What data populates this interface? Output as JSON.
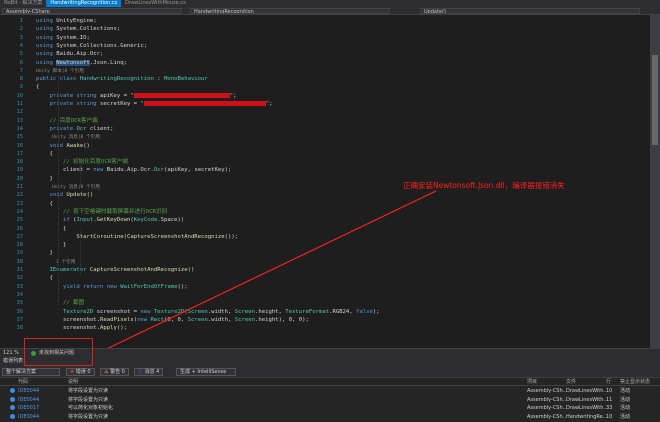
{
  "window": {
    "title_fragment": "NoBit · 解决方案"
  },
  "tabs": [
    {
      "label": "HandwritingRecognition.cs",
      "active": true
    },
    {
      "label": "DrawLinesWithMouse.cs",
      "active": false
    }
  ],
  "navbar": {
    "project": "Assembly-CSharp",
    "class": "HandwritingRecognition",
    "member": "Update()"
  },
  "code_lines": [
    {
      "n": "1",
      "html": "<span class=\"kw\">using</span> UnityEngine;"
    },
    {
      "n": "2",
      "html": "<span class=\"kw\">using</span> System.Collections;"
    },
    {
      "n": "3",
      "html": "<span class=\"kw\">using</span> System.IO;"
    },
    {
      "n": "4",
      "html": "<span class=\"kw\">using</span> System.Collections.Generic;"
    },
    {
      "n": "5",
      "html": "<span class=\"kw\">using</span> Baidu.Aip.Ocr;"
    },
    {
      "n": "6",
      "html": "<span class=\"kw\">using</span> <span class=\"hl\">Newtonsoft</span>.Json.Linq;"
    },
    {
      "n": "7",
      "html": ""
    },
    {
      "n": "8",
      "html": "<span class=\"kw\">public class</span> <span class=\"ty\">HandwritingRecognition</span> : <span class=\"ty\">MonoBehaviour</span>"
    },
    {
      "n": "9",
      "html": "{"
    },
    {
      "n": "10",
      "html": "    <span class=\"kw\">private string</span> apiKey = <span class=\"st\">\"<span class=\"redact\"></span>\"</span>;"
    },
    {
      "n": "11",
      "html": "    <span class=\"kw\">private string</span> secretKey = <span class=\"st\">\"<span class=\"redact2\"></span>\"</span>;"
    },
    {
      "n": "12",
      "html": ""
    },
    {
      "n": "13",
      "html": "    <span class=\"cm\">// 百度OCR客户端</span>"
    },
    {
      "n": "14",
      "html": "    <span class=\"kw\">private</span> <span class=\"ty\">Ocr</span> client;"
    },
    {
      "n": "15",
      "html": ""
    },
    {
      "n": "16",
      "html": "    <span class=\"kw\">void</span> <span class=\"fn\">Awake</span>()"
    },
    {
      "n": "17",
      "html": "    {"
    },
    {
      "n": "18",
      "html": "        <span class=\"cm\">// 初始化百度OCR客户端</span>"
    },
    {
      "n": "19",
      "html": "        client = <span class=\"kw\">new</span> Baidu.Aip.Ocr.<span class=\"ty\">Ocr</span>(apiKey, secretKey);"
    },
    {
      "n": "20",
      "html": "    }"
    },
    {
      "n": "21",
      "html": ""
    },
    {
      "n": "22",
      "html": "    <span class=\"kw\">void</span> <span class=\"fn\">Update</span>()"
    },
    {
      "n": "23",
      "html": "    {"
    },
    {
      "n": "24",
      "html": "        <span class=\"cm\">// 按下空格键时截取屏幕并进行OCR识别</span>"
    },
    {
      "n": "25",
      "html": "        <span class=\"kw\">if</span> (<span class=\"ty\">Input</span>.<span class=\"fn\">GetKeyDown</span>(<span class=\"ty\">KeyCode</span>.Space))"
    },
    {
      "n": "26",
      "html": "        {"
    },
    {
      "n": "27",
      "html": "            <span class=\"fn\">StartCoroutine</span>(<span class=\"fn\">CaptureScreenshotAndRecognize</span>());"
    },
    {
      "n": "28",
      "html": "        }"
    },
    {
      "n": "29",
      "html": "    }"
    },
    {
      "n": "30",
      "html": ""
    },
    {
      "n": "31",
      "html": "    <span class=\"ty\">IEnumerator</span> <span class=\"fn\">CaptureScreenshotAndRecognize</span>()"
    },
    {
      "n": "32",
      "html": "    {"
    },
    {
      "n": "33",
      "html": "        <span class=\"kw\">yield return new</span> <span class=\"ty\">WaitForEndOfFrame</span>();"
    },
    {
      "n": "34",
      "html": ""
    },
    {
      "n": "35",
      "html": "        <span class=\"cm\">// 截图</span>"
    },
    {
      "n": "36",
      "html": "        <span class=\"ty\">Texture2D</span> screenshot = <span class=\"kw\">new</span> <span class=\"ty\">Texture2D</span>(<span class=\"ty\">Screen</span>.width, <span class=\"ty\">Screen</span>.height, <span class=\"ty\">TextureFormat</span>.RGB24, <span class=\"kw\">false</span>);"
    },
    {
      "n": "37",
      "html": "        screenshot.<span class=\"fn\">ReadPixels</span>(<span class=\"kw\">new</span> <span class=\"ty\">Rect</span>(0, 0, <span class=\"ty\">Screen</span>.width, <span class=\"ty\">Screen</span>.height), 0, 0);"
    },
    {
      "n": "38",
      "html": "        screenshot.<span class=\"fn\">Apply</span>();"
    }
  ],
  "codelens": [
    {
      "after_line": "7",
      "text": "Unity 脚本|0 个引用"
    },
    {
      "after_line": "15",
      "text": "Unity 消息|0 个引用"
    },
    {
      "after_line": "21",
      "text": "Unity 消息|0 个引用"
    },
    {
      "after_line": "30",
      "text": "1 个引用"
    }
  ],
  "annotation": {
    "text": "正确安装Newtonsoft.Json.dll，编译器报错消失",
    "color": "#ff2020"
  },
  "statusbar": {
    "zoom": "121 %",
    "issues": "未找到相关问题"
  },
  "error_panel": {
    "title": "错误列表",
    "scope": "整个解决方案",
    "errors_chip": "错误 0",
    "warnings_chip": "警告 0",
    "messages_chip": "消息 4",
    "build_filter": "生成 + IntelliSense",
    "columns": [
      "代码",
      "说明",
      "项目",
      "文件",
      "行",
      "禁止显示状态"
    ],
    "rows": [
      {
        "code": "IDE0044",
        "desc": "将字段设置为只读",
        "project": "Assembly-CSh...",
        "file": "DrawLinesWith...",
        "line": "10",
        "state": "活动"
      },
      {
        "code": "IDE0044",
        "desc": "将字段设置为只读",
        "project": "Assembly-CSh...",
        "file": "DrawLinesWith...",
        "line": "11",
        "state": "活动"
      },
      {
        "code": "IDE0017",
        "desc": "可以简化对象初始化",
        "project": "Assembly-CSh...",
        "file": "DrawLinesWith...",
        "line": "33",
        "state": "活动"
      },
      {
        "code": "IDE0044",
        "desc": "将字段设置为只读",
        "project": "Assembly-CSh...",
        "file": "HandwritingRe...",
        "line": "10",
        "state": "活动"
      }
    ]
  }
}
